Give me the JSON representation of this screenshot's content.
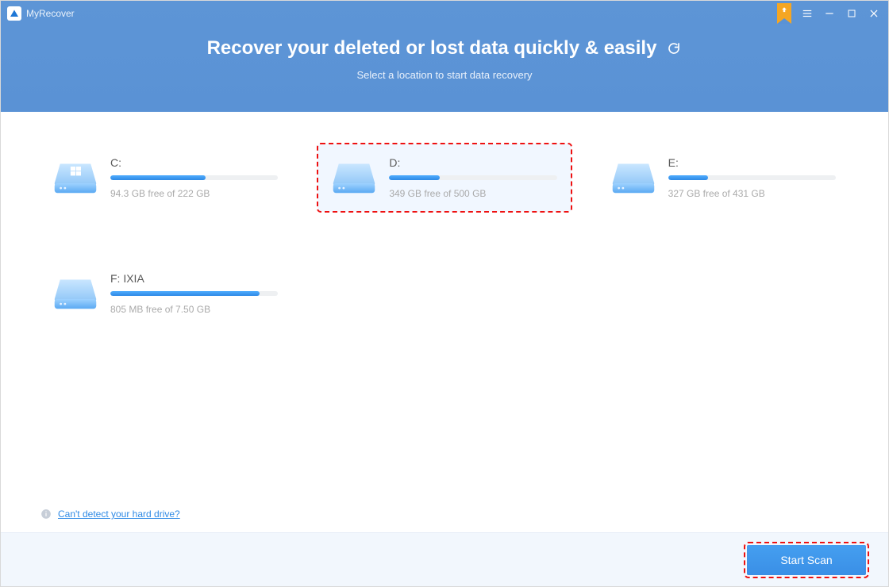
{
  "app": {
    "name": "MyRecover"
  },
  "hero": {
    "title": "Recover your deleted or lost data quickly & easily",
    "subtitle": "Select a location to start data recovery"
  },
  "drives": [
    {
      "label": "C:",
      "meta": "94.3 GB free of 222 GB",
      "used_pct": 57,
      "selected": false,
      "windows": true
    },
    {
      "label": "D:",
      "meta": "349 GB free of 500 GB",
      "used_pct": 30,
      "selected": true,
      "windows": false
    },
    {
      "label": "E:",
      "meta": "327 GB free of 431 GB",
      "used_pct": 24,
      "selected": false,
      "windows": false
    },
    {
      "label": "F: IXIA",
      "meta": "805 MB free of 7.50 GB",
      "used_pct": 89,
      "selected": false,
      "windows": false
    }
  ],
  "help_link": "Can't detect your hard drive? ",
  "footer": {
    "start_scan": "Start Scan"
  }
}
